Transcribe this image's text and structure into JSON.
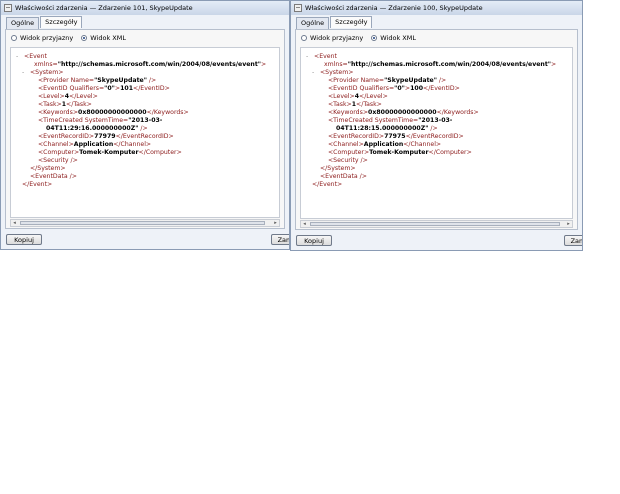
{
  "windows": [
    {
      "title": "Właściwości zdarzenia — Zdarzenie 101, SkypeUpdate",
      "tabs": [
        "Ogólne",
        "Szczegóły"
      ],
      "active_tab": "Szczegóły",
      "radios": [
        "Widok przyjazny",
        "Widok XML"
      ],
      "selected_radio": "Widok XML",
      "xml": {
        "event_tag": "Event",
        "xmlns_attr": "xmlns=",
        "xmlns_value": "\"http://schemas.microsoft.com/win/2004/08/events/event\"",
        "system_open": "<System>",
        "provider_tag": "<Provider Name=",
        "provider_value": "\"SkypeUpdate\"",
        "provider_end": " />",
        "eventid_tag": "<EventID Qualifiers=",
        "eventid_qual": "\"0\"",
        "eventid_mid": ">",
        "eventid_value": "101",
        "eventid_close": "</EventID>",
        "level_open": "<Level>",
        "level_value": "4",
        "level_close": "</Level>",
        "task_open": "<Task>",
        "task_value": "1",
        "task_close": "</Task>",
        "keywords_open": "<Keywords>",
        "keywords_value": "0x80000000000000",
        "keywords_close": "</Keywords>",
        "timecreated_tag": "<TimeCreated SystemTime=",
        "timecreated_value1": "\"2013-03-",
        "timecreated_value2": "04T11:29:16.000000000Z\"",
        "timecreated_end": " />",
        "recordid_open": "<EventRecordID>",
        "recordid_value": "77979",
        "recordid_close": "</EventRecordID>",
        "channel_open": "<Channel>",
        "channel_value": "Application",
        "channel_close": "</Channel>",
        "computer_open": "<Computer>",
        "computer_value": "Tomek-Komputer",
        "computer_close": "</Computer>",
        "security": "<Security />",
        "system_close": "</System>",
        "eventdata": "<EventData />",
        "event_close": "</Event>"
      },
      "buttons": {
        "copy": "Kopiuj",
        "close": "Zam"
      }
    },
    {
      "title": "Właściwości zdarzenia — Zdarzenie 100, SkypeUpdate",
      "tabs": [
        "Ogólne",
        "Szczegóły"
      ],
      "active_tab": "Szczegóły",
      "radios": [
        "Widok przyjazny",
        "Widok XML"
      ],
      "selected_radio": "Widok XML",
      "xml": {
        "event_tag": "Event",
        "xmlns_attr": "xmlns=",
        "xmlns_value": "\"http://schemas.microsoft.com/win/2004/08/events/event\"",
        "system_open": "<System>",
        "provider_tag": "<Provider Name=",
        "provider_value": "\"SkypeUpdate\"",
        "provider_end": " />",
        "eventid_tag": "<EventID Qualifiers=",
        "eventid_qual": "\"0\"",
        "eventid_mid": ">",
        "eventid_value": "100",
        "eventid_close": "</EventID>",
        "level_open": "<Level>",
        "level_value": "4",
        "level_close": "</Level>",
        "task_open": "<Task>",
        "task_value": "1",
        "task_close": "</Task>",
        "keywords_open": "<Keywords>",
        "keywords_value": "0x80000000000000",
        "keywords_close": "</Keywords>",
        "timecreated_tag": "<TimeCreated SystemTime=",
        "timecreated_value1": "\"2013-03-",
        "timecreated_value2": "04T11:28:15.000000000Z\"",
        "timecreated_end": " />",
        "recordid_open": "<EventRecordID>",
        "recordid_value": "77975",
        "recordid_close": "</EventRecordID>",
        "channel_open": "<Channel>",
        "channel_value": "Application",
        "channel_close": "</Channel>",
        "computer_open": "<Computer>",
        "computer_value": "Tomek-Komputer",
        "computer_close": "</Computer>",
        "security": "<Security />",
        "system_close": "</System>",
        "eventdata": "<EventData />",
        "event_close": "</Event>"
      },
      "buttons": {
        "copy": "Kopiuj",
        "close": "Zam"
      }
    }
  ]
}
